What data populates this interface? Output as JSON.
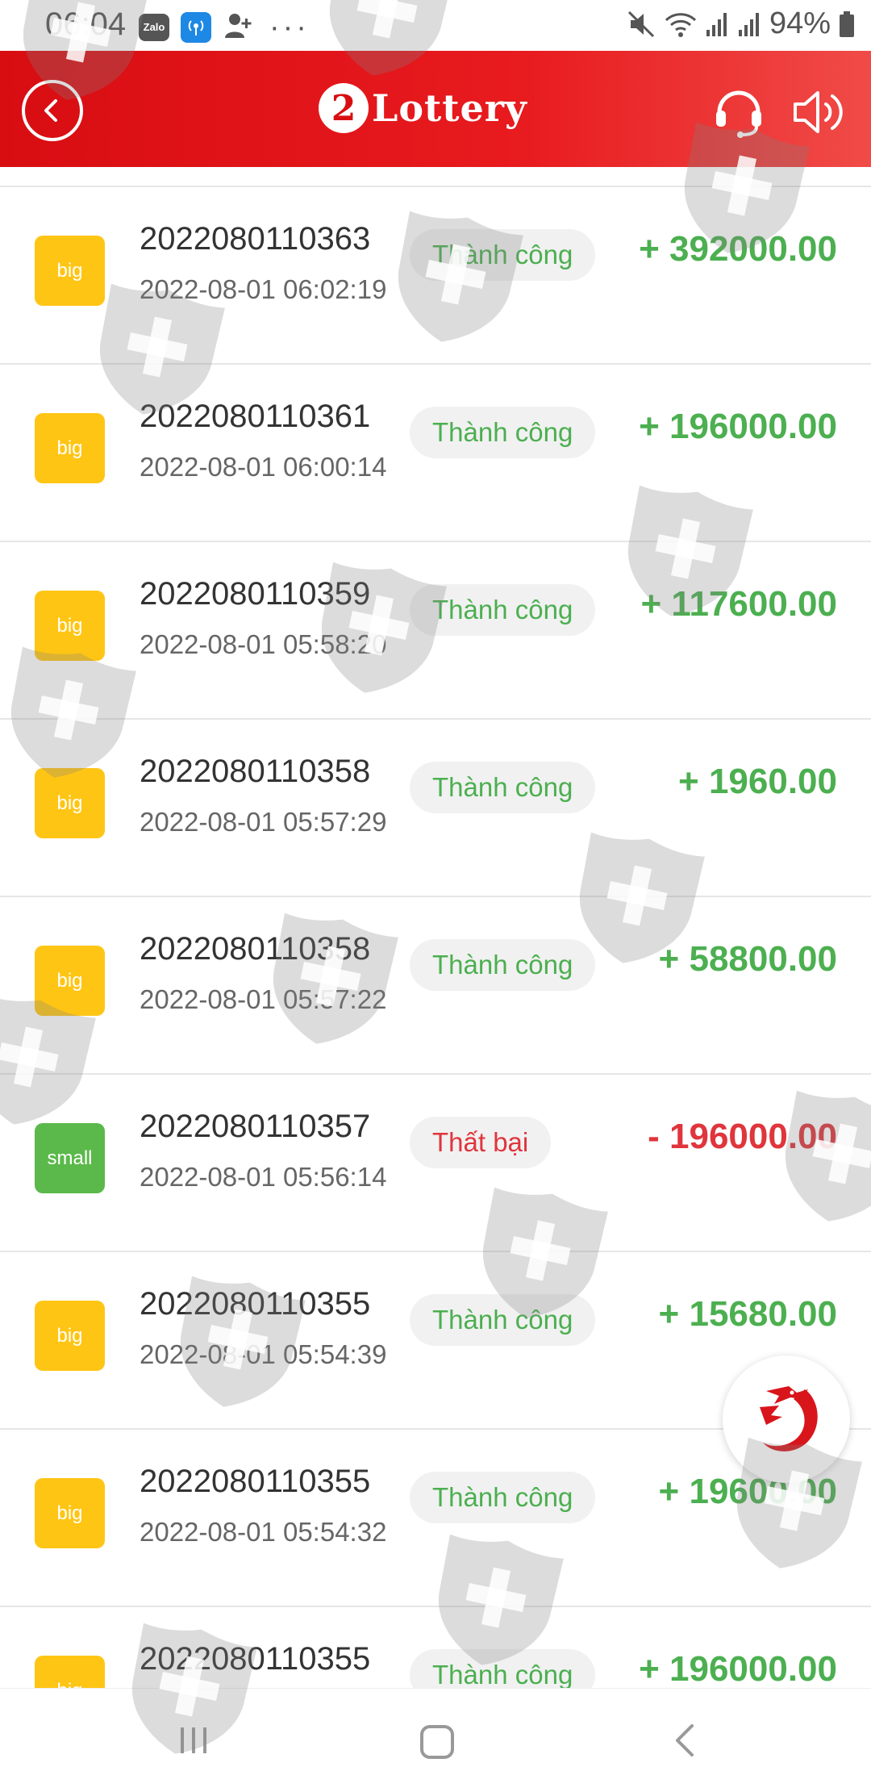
{
  "status": {
    "time": "06:04",
    "zalo_label": "Zalo",
    "battery": "94%"
  },
  "header": {
    "logo_mark": "2",
    "logo_text": "Lottery",
    "icons": [
      "back-icon",
      "headset-icon",
      "speaker-icon"
    ]
  },
  "transactions": [
    {
      "type": "big",
      "issue": "2022080110363",
      "time": "2022-08-01 06:02:19",
      "status": "Thành công",
      "result": "win",
      "amount": "+ 392000.00"
    },
    {
      "type": "big",
      "issue": "2022080110361",
      "time": "2022-08-01 06:00:14",
      "status": "Thành công",
      "result": "win",
      "amount": "+ 196000.00"
    },
    {
      "type": "big",
      "issue": "2022080110359",
      "time": "2022-08-01 05:58:20",
      "status": "Thành công",
      "result": "win",
      "amount": "+ 117600.00"
    },
    {
      "type": "big",
      "issue": "2022080110358",
      "time": "2022-08-01 05:57:29",
      "status": "Thành công",
      "result": "win",
      "amount": "+ 1960.00"
    },
    {
      "type": "big",
      "issue": "2022080110358",
      "time": "2022-08-01 05:57:22",
      "status": "Thành công",
      "result": "win",
      "amount": "+ 58800.00"
    },
    {
      "type": "small",
      "issue": "2022080110357",
      "time": "2022-08-01 05:56:14",
      "status": "Thất bại",
      "result": "lose",
      "amount": "- 196000.00"
    },
    {
      "type": "big",
      "issue": "2022080110355",
      "time": "2022-08-01 05:54:39",
      "status": "Thành công",
      "result": "win",
      "amount": "+ 15680.00"
    },
    {
      "type": "big",
      "issue": "2022080110355",
      "time": "2022-08-01 05:54:32",
      "status": "Thành công",
      "result": "win",
      "amount": "+ 19600.00"
    },
    {
      "type": "big",
      "issue": "2022080110355",
      "time": "",
      "status": "Thành công",
      "result": "win",
      "amount": "+ 196000.00"
    }
  ],
  "colors": {
    "header_red": "#d80d12",
    "win_green": "#4caf50",
    "lose_red": "#e0353c",
    "badge_big": "#ffc514",
    "badge_small": "#5ab94a"
  }
}
